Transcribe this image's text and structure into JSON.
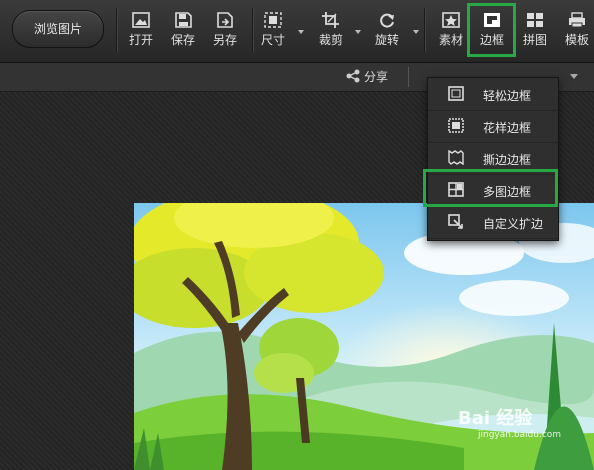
{
  "toolbar": {
    "browse_label": "浏览图片",
    "buttons": [
      {
        "label": "打开",
        "icon": "open-image-icon"
      },
      {
        "label": "保存",
        "icon": "save-icon"
      },
      {
        "label": "另存",
        "icon": "save-as-icon"
      },
      {
        "label": "尺寸",
        "icon": "resize-icon",
        "dropdown": true
      },
      {
        "label": "裁剪",
        "icon": "crop-icon",
        "dropdown": true
      },
      {
        "label": "旋转",
        "icon": "rotate-icon",
        "dropdown": true
      },
      {
        "label": "素材",
        "icon": "sticker-star-icon"
      },
      {
        "label": "边框",
        "icon": "frame-icon",
        "active": true
      },
      {
        "label": "拼图",
        "icon": "collage-grid-icon"
      },
      {
        "label": "模板",
        "icon": "template-printer-icon"
      }
    ]
  },
  "subbar": {
    "share_label": "分享"
  },
  "frame_menu": {
    "items": [
      {
        "label": "轻松边框",
        "icon": "simple-frame-icon"
      },
      {
        "label": "花样边框",
        "icon": "pattern-frame-icon"
      },
      {
        "label": "撕边边框",
        "icon": "torn-edge-frame-icon"
      },
      {
        "label": "多图边框",
        "icon": "multi-image-frame-icon",
        "highlighted": true
      },
      {
        "label": "自定义扩边",
        "icon": "custom-expand-icon"
      }
    ]
  },
  "watermark": {
    "brand": "Bai 经验",
    "url": "jingyan.baidu.com"
  },
  "colors": {
    "highlight": "#27a844",
    "toolbar": "#2f2f2f"
  }
}
